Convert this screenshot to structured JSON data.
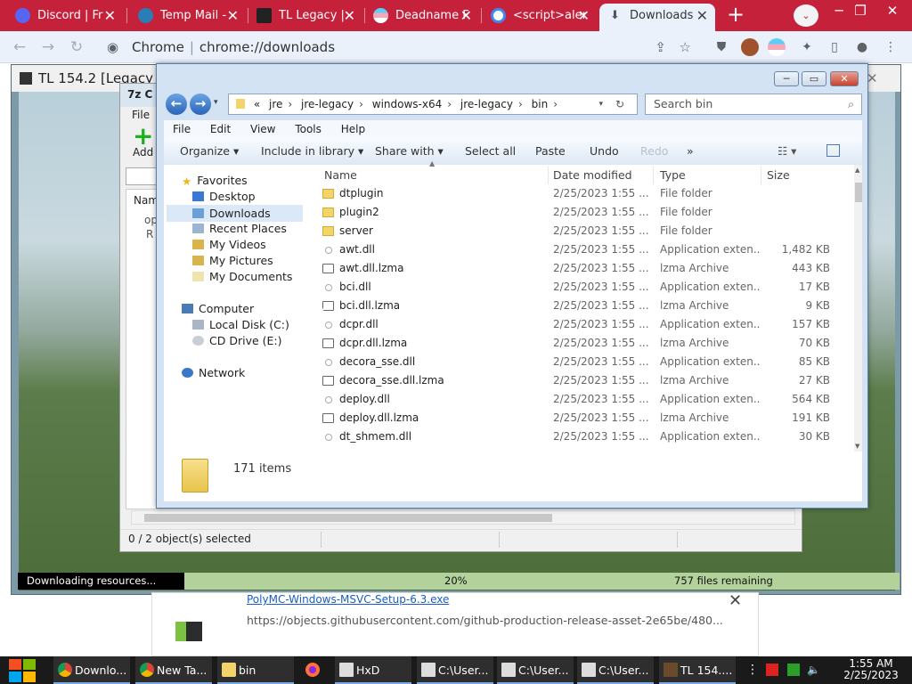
{
  "browser": {
    "tabs": [
      {
        "label": "Discord | Fr",
        "icon": "discord-icon",
        "color": "#5865f2"
      },
      {
        "label": "Temp Mail -",
        "icon": "tempmail-icon",
        "color": "#2a7db5"
      },
      {
        "label": "TL Legacy |",
        "icon": "cube-icon",
        "color": "#222222"
      },
      {
        "label": "Deadname F",
        "icon": "flag-icon",
        "color": "#f4a8b8"
      },
      {
        "label": "<script>aler",
        "icon": "google-icon",
        "color": "#ffffff"
      },
      {
        "label": "Downloads",
        "icon": "download-icon",
        "color": "#444444"
      }
    ],
    "new_tab": "+",
    "menu_glyph": "⌄",
    "window_controls": [
      "─",
      "❐",
      "✕"
    ],
    "omnibox_site": "Chrome",
    "omnibox_url": "chrome://downloads",
    "accent": "#c5213a"
  },
  "tl_window": {
    "title": "TL 154.2 [Legacy",
    "progress_text": "Downloading resources...",
    "percent": "20%",
    "remaining": "757 files remaining"
  },
  "download": {
    "name": "PolyMC-Windows-MSVC-Setup-6.3.exe",
    "url": "https://objects.githubusercontent.com/github-production-release-asset-2e65be/480...",
    "close": "✕"
  },
  "z7": {
    "title_glyph": "7z C",
    "menu_file": "File",
    "add_label": "Add",
    "col_name": "Name",
    "rows": [
      "op",
      "R"
    ],
    "status": "0 / 2 object(s) selected"
  },
  "explorer": {
    "caption_min": "─",
    "caption_max": "▭",
    "caption_close": "✕",
    "breadcrumb": [
      "«",
      "jre",
      "jre-legacy",
      "windows-x64",
      "jre-legacy",
      "bin"
    ],
    "search_placeholder": "Search bin",
    "menu": [
      "File",
      "Edit",
      "View",
      "Tools",
      "Help"
    ],
    "commands": [
      "Organize ▾",
      "Include in library ▾",
      "Share with ▾",
      "Select all",
      "Paste",
      "Undo",
      "Redo",
      "»"
    ],
    "nav": {
      "favorites": "Favorites",
      "desktop": "Desktop",
      "downloads": "Downloads",
      "recent": "Recent Places",
      "videos": "My Videos",
      "pictures": "My Pictures",
      "documents": "My Documents",
      "computer": "Computer",
      "local_disk": "Local Disk (C:)",
      "cd_drive": "CD Drive (E:)",
      "network": "Network"
    },
    "columns": {
      "name": "Name",
      "date": "Date modified",
      "type": "Type",
      "size": "Size"
    },
    "files": [
      {
        "name": "dtplugin",
        "date": "2/25/2023 1:55 ...",
        "type": "File folder",
        "size": "",
        "kind": "folder"
      },
      {
        "name": "plugin2",
        "date": "2/25/2023 1:55 ...",
        "type": "File folder",
        "size": "",
        "kind": "folder"
      },
      {
        "name": "server",
        "date": "2/25/2023 1:55 ...",
        "type": "File folder",
        "size": "",
        "kind": "folder"
      },
      {
        "name": "awt.dll",
        "date": "2/25/2023 1:55 ...",
        "type": "Application exten...",
        "size": "1,482 KB",
        "kind": "dll"
      },
      {
        "name": "awt.dll.lzma",
        "date": "2/25/2023 1:55 ...",
        "type": "lzma Archive",
        "size": "443 KB",
        "kind": "lzma"
      },
      {
        "name": "bci.dll",
        "date": "2/25/2023 1:55 ...",
        "type": "Application exten...",
        "size": "17 KB",
        "kind": "dll"
      },
      {
        "name": "bci.dll.lzma",
        "date": "2/25/2023 1:55 ...",
        "type": "lzma Archive",
        "size": "9 KB",
        "kind": "lzma"
      },
      {
        "name": "dcpr.dll",
        "date": "2/25/2023 1:55 ...",
        "type": "Application exten...",
        "size": "157 KB",
        "kind": "dll"
      },
      {
        "name": "dcpr.dll.lzma",
        "date": "2/25/2023 1:55 ...",
        "type": "lzma Archive",
        "size": "70 KB",
        "kind": "lzma"
      },
      {
        "name": "decora_sse.dll",
        "date": "2/25/2023 1:55 ...",
        "type": "Application exten...",
        "size": "85 KB",
        "kind": "dll"
      },
      {
        "name": "decora_sse.dll.lzma",
        "date": "2/25/2023 1:55 ...",
        "type": "lzma Archive",
        "size": "27 KB",
        "kind": "lzma"
      },
      {
        "name": "deploy.dll",
        "date": "2/25/2023 1:55 ...",
        "type": "Application exten...",
        "size": "564 KB",
        "kind": "dll"
      },
      {
        "name": "deploy.dll.lzma",
        "date": "2/25/2023 1:55 ...",
        "type": "lzma Archive",
        "size": "191 KB",
        "kind": "lzma"
      },
      {
        "name": "dt_shmem.dll",
        "date": "2/25/2023 1:55 ...",
        "type": "Application exten...",
        "size": "30 KB",
        "kind": "dll"
      }
    ],
    "item_count": "171 items"
  },
  "taskbar": {
    "items": [
      {
        "label": "Downlo...",
        "icon": "chrome-icon"
      },
      {
        "label": "New Ta...",
        "icon": "chrome-icon"
      },
      {
        "label": "bin",
        "icon": "folder-icon"
      },
      {
        "label": "",
        "icon": "firefox-icon"
      },
      {
        "label": "HxD",
        "icon": "hxd-icon"
      },
      {
        "label": "C:\\User...",
        "icon": "7zip-icon"
      },
      {
        "label": "C:\\User...",
        "icon": "7zip-icon"
      },
      {
        "label": "C:\\User...",
        "icon": "7zip-icon"
      },
      {
        "label": "TL 154....",
        "icon": "cube-icon"
      }
    ],
    "time": "1:55 AM",
    "date": "2/25/2023"
  }
}
